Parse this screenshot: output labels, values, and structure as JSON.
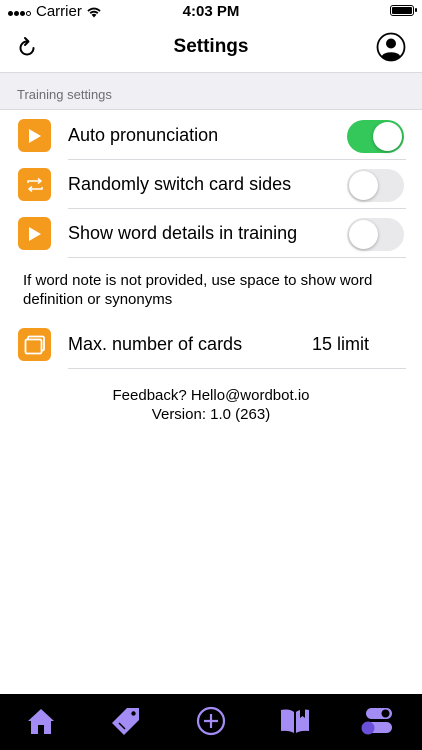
{
  "status_bar": {
    "carrier": "Carrier",
    "time": "4:03 PM"
  },
  "nav": {
    "title": "Settings",
    "refresh_icon": "refresh-icon",
    "profile_icon": "profile-icon"
  },
  "section": {
    "title": "Training settings"
  },
  "rows": [
    {
      "label": "Auto pronunciation",
      "icon": "play-icon",
      "toggle": true
    },
    {
      "label": "Randomly switch card sides",
      "icon": "switch-icon",
      "toggle": false
    },
    {
      "label": "Show word details in training",
      "icon": "play-icon",
      "toggle": false
    }
  ],
  "note": "If word note is not provided, use space to show word definition or synonyms",
  "max_cards": {
    "label": "Max. number of cards",
    "value": "15 limit",
    "icon": "cards-icon"
  },
  "footer": {
    "feedback": "Feedback? Hello@wordbot.io",
    "version": "Version: 1.0 (263)"
  },
  "tabs": [
    {
      "name": "home",
      "icon": "home-icon"
    },
    {
      "name": "tags",
      "icon": "tag-icon"
    },
    {
      "name": "add",
      "icon": "add-icon"
    },
    {
      "name": "book",
      "icon": "book-icon"
    },
    {
      "name": "settings",
      "icon": "settings-toggle-icon",
      "selected": true
    }
  ],
  "colors": {
    "accent": "#f49a1c",
    "toggle_on": "#34c759",
    "tab_icon": "#a48cf5",
    "tab_bar": "#000000"
  }
}
